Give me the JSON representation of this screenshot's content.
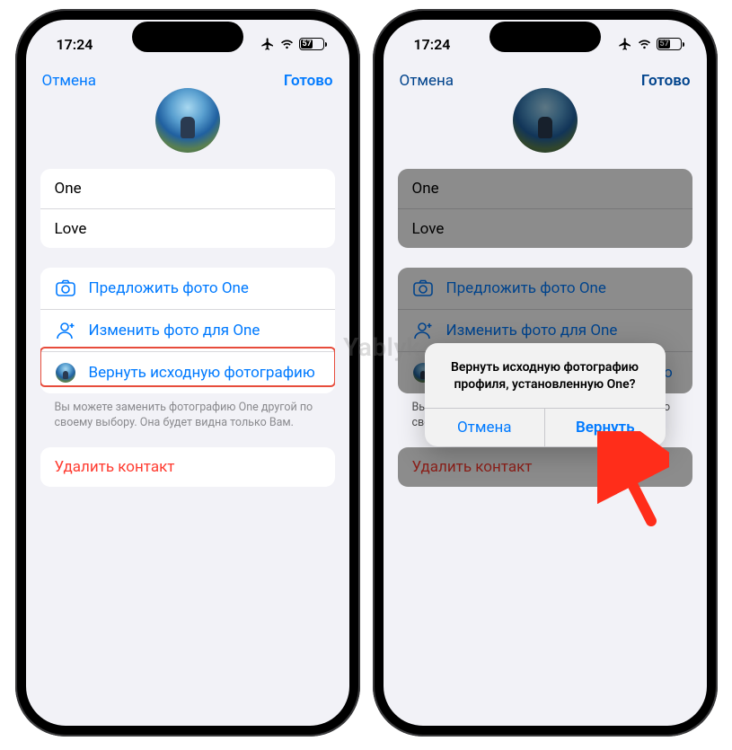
{
  "status": {
    "time": "17:24",
    "battery_pct": "57"
  },
  "nav": {
    "cancel": "Отмена",
    "done": "Готово"
  },
  "fields": {
    "first_name": "One",
    "last_name": "Love"
  },
  "actions": {
    "suggest_photo": "Предложить фото One",
    "change_photo": "Изменить фото для One",
    "restore_photo": "Вернуть исходную фотографию"
  },
  "footnote": "Вы можете заменить фотографию One другой по своему выбору. Она будет видна только Вам.",
  "delete": "Удалить контакт",
  "alert": {
    "message": "Вернуть исходную фотографию профиля, установленную One?",
    "cancel": "Отмена",
    "confirm": "Вернуть"
  },
  "watermark": "Yablyk"
}
